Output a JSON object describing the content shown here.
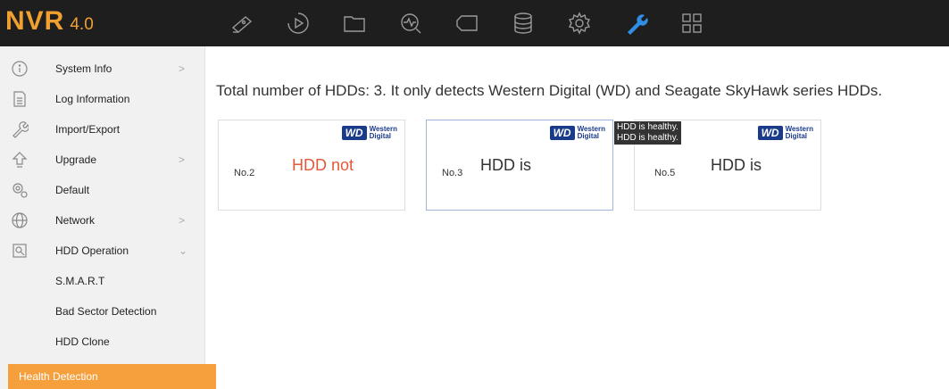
{
  "app": {
    "name": "NVR",
    "version": "4.0"
  },
  "topnav": [
    {
      "icon": "camera-icon"
    },
    {
      "icon": "playback-icon"
    },
    {
      "icon": "folder-icon"
    },
    {
      "icon": "monitor-icon"
    },
    {
      "icon": "tag-icon"
    },
    {
      "icon": "storage-icon"
    },
    {
      "icon": "gear-icon"
    },
    {
      "icon": "wrench-icon",
      "active": true
    },
    {
      "icon": "grid-icon"
    }
  ],
  "sidebar": {
    "items": [
      {
        "label": "System Info",
        "icon": "info-icon",
        "chevron": ">"
      },
      {
        "label": "Log Information",
        "icon": "document-icon"
      },
      {
        "label": "Import/Export",
        "icon": "wrench-icon"
      },
      {
        "label": "Upgrade",
        "icon": "upgrade-icon",
        "chevron": ">"
      },
      {
        "label": "Default",
        "icon": "default-icon"
      },
      {
        "label": "Network",
        "icon": "globe-icon",
        "chevron": ">"
      },
      {
        "label": "HDD Operation",
        "icon": "hdd-icon",
        "chevron": "⌄"
      }
    ],
    "subitems": [
      {
        "label": "S.M.A.R.T"
      },
      {
        "label": "Bad Sector Detection"
      },
      {
        "label": "HDD Clone"
      },
      {
        "label": "Health Detection",
        "active": true
      }
    ]
  },
  "main": {
    "heading": "Total number of HDDs: 3. It only detects Western Digital (WD) and Seagate SkyHawk series HDDs.",
    "cards": [
      {
        "no": "No.2",
        "status": "HDD not",
        "status_color": "#e05a3a",
        "brand_badge": "WD",
        "brand_line1": "Western",
        "brand_line2": "Digital"
      },
      {
        "no": "No.3",
        "status": "HDD is",
        "brand_badge": "WD",
        "brand_line1": "Western",
        "brand_line2": "Digital"
      },
      {
        "no": "No.5",
        "status": "HDD is",
        "brand_badge": "WD",
        "brand_line1": "Western",
        "brand_line2": "Digital"
      }
    ],
    "tooltip": {
      "line1": "HDD is healthy.",
      "line2": "HDD is healthy."
    }
  },
  "colors": {
    "accent": "#f5a03c",
    "topbar": "#1e1e1e",
    "logo": "#f0a030",
    "active_icon": "#2f8fe6",
    "error": "#e05a3a"
  }
}
